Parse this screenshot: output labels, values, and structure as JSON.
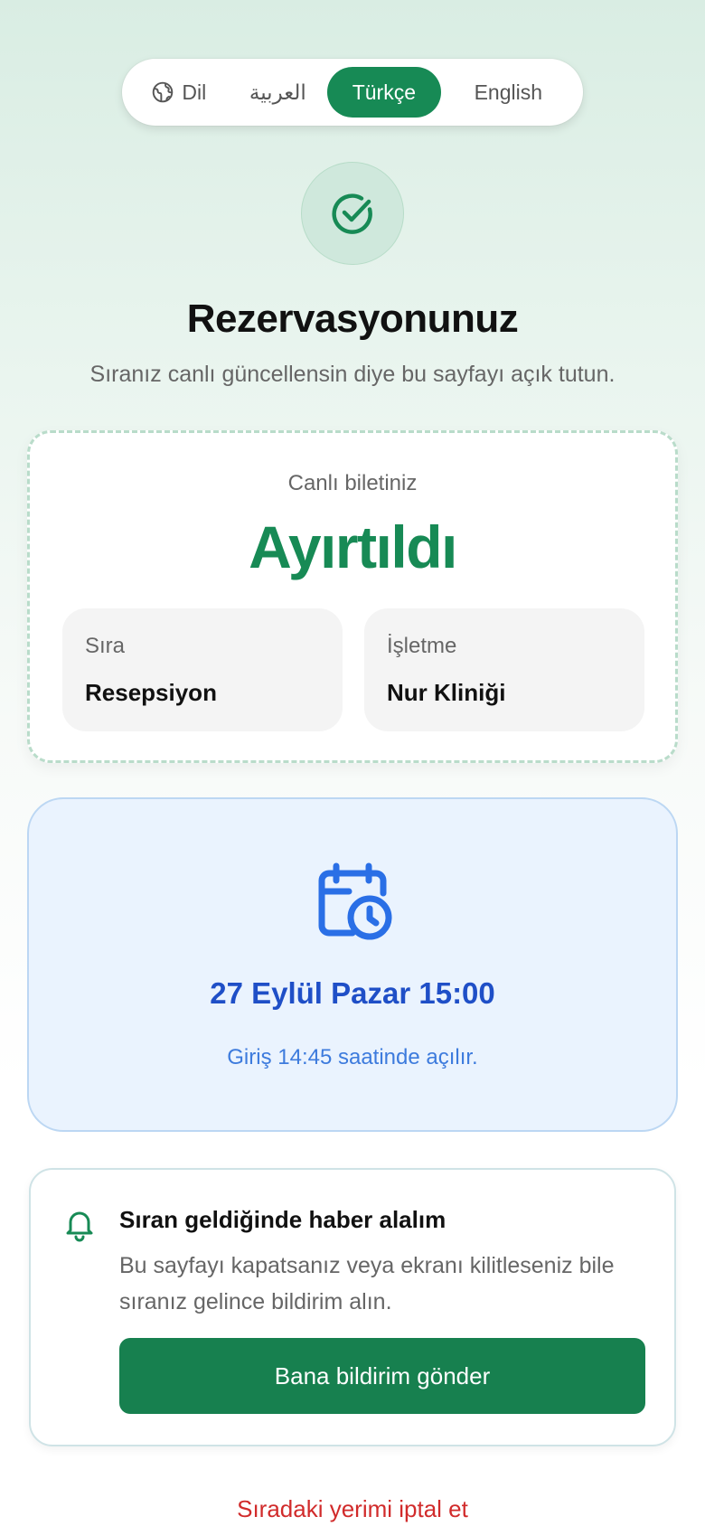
{
  "language_switcher": {
    "label": "Dil",
    "options": [
      "العربية",
      "Türkçe",
      "English"
    ],
    "selected": "Türkçe"
  },
  "header": {
    "title": "Rezervasyonunuz",
    "subtitle": "Sıranız canlı güncellensin diye bu sayfayı açık tutun."
  },
  "ticket": {
    "label": "Canlı biletiniz",
    "status": "Ayırtıldı",
    "queue_label": "Sıra",
    "queue_value": "Resepsiyon",
    "business_label": "İşletme",
    "business_value": "Nur Kliniği"
  },
  "appointment": {
    "datetime": "27 Eylül Pazar 15:00",
    "note": "Giriş 14:45 saatinde açılır."
  },
  "notification": {
    "title": "Sıran geldiğinde haber alalım",
    "body": "Bu sayfayı kapatsanız veya ekranı kilitleseniz bile sıranız gelince bildirim alın.",
    "button_label": "Bana bildirim gönder"
  },
  "cancel_label": "Sıradaki yerimi iptal et",
  "colors": {
    "brand_green": "#178a55",
    "appointment_blue": "#1f4fc7",
    "danger_red": "#d12b2b"
  }
}
